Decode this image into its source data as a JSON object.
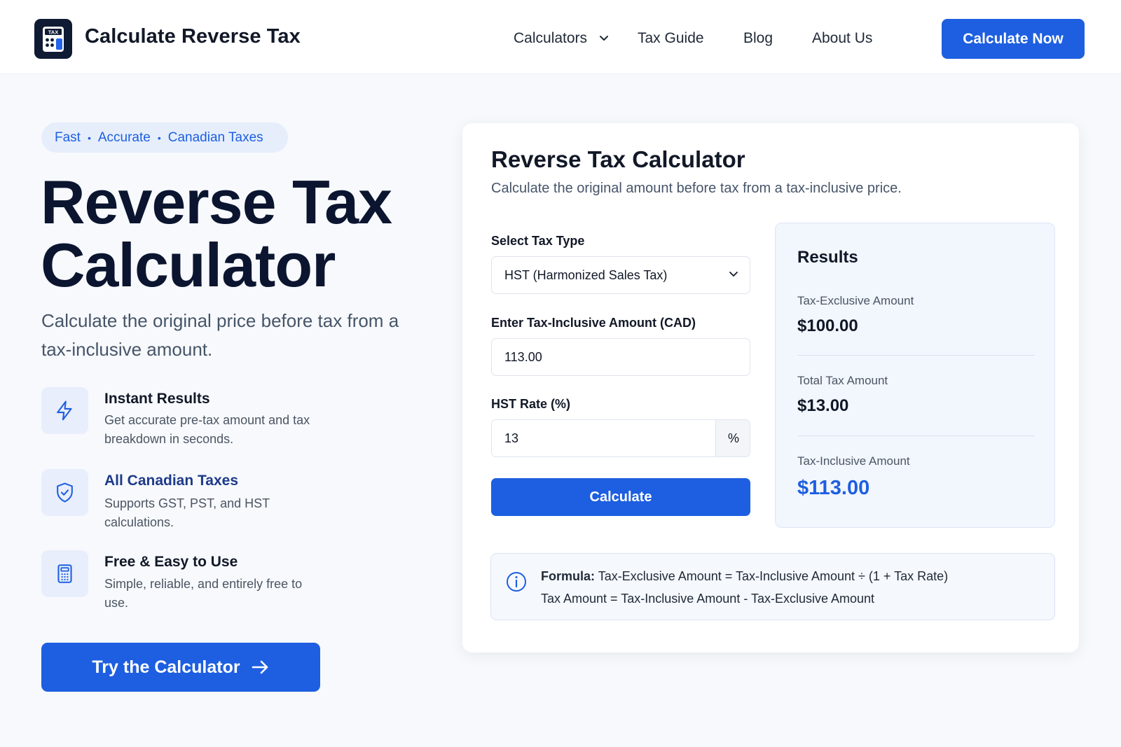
{
  "header": {
    "logo_text": "TAX",
    "brand": "Calculate Reverse Tax",
    "nav": {
      "calculators": "Calculators",
      "tax_guide": "Tax Guide",
      "blog": "Blog",
      "about": "About Us"
    },
    "cta": "Calculate Now"
  },
  "hero": {
    "pill": [
      "Fast",
      "Accurate",
      "Canadian Taxes"
    ],
    "title_line1": "Reverse Tax",
    "title_line2": "Calculator",
    "subtitle": "Calculate the original price before tax from a tax-inclusive amount.",
    "features": [
      {
        "icon": "lightning-icon",
        "title": "Instant Results",
        "desc": "Get accurate pre-tax amount and tax breakdown in seconds."
      },
      {
        "icon": "shield-check-icon",
        "title": "All Canadian Taxes",
        "desc": "Supports GST, PST, and HST calculations."
      },
      {
        "icon": "calculator-icon",
        "title": "Free & Easy to Use",
        "desc": "Simple, reliable, and entirely free to use."
      }
    ],
    "cta": "Try the Calculator"
  },
  "calculator": {
    "title": "Reverse Tax Calculator",
    "subtitle": "Calculate the original amount before tax from a tax-inclusive price.",
    "tax_type_label": "Select Tax Type",
    "tax_type_value": "HST (Harmonized Sales Tax)",
    "amount_label": "Enter Tax-Inclusive Amount (CAD)",
    "amount_value": "113.00",
    "rate_label": "HST Rate (%)",
    "rate_value": "13",
    "rate_suffix": "%",
    "calculate_button": "Calculate",
    "results": {
      "title": "Results",
      "exclusive_label": "Tax-Exclusive Amount",
      "exclusive_value": "$100.00",
      "tax_label": "Total Tax Amount",
      "tax_value": "$13.00",
      "inclusive_label": "Tax-Inclusive Amount",
      "inclusive_value": "$113.00"
    },
    "formula": {
      "prefix": "Formula:",
      "line1": "Tax-Exclusive Amount = Tax-Inclusive Amount ÷ (1 + Tax Rate)",
      "line2": "Tax Amount = Tax-Inclusive Amount - Tax-Exclusive Amount"
    }
  },
  "colors": {
    "accent": "#1d5fe0",
    "dark": "#0b1530",
    "background": "#f7f9fc"
  }
}
